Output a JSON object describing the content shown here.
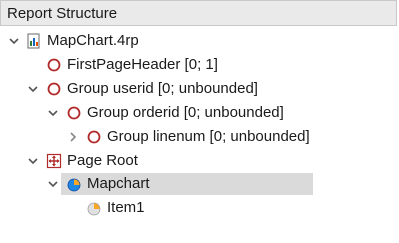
{
  "panel": {
    "title": "Report Structure"
  },
  "tree": {
    "root_file": "MapChart.4rp",
    "first_page_header": "FirstPageHeader [0; 1]",
    "group_userid": "Group userid [0; unbounded]",
    "group_orderid": "Group orderid [0; unbounded]",
    "group_linenum": "Group linenum [0; unbounded]",
    "page_root": "Page Root",
    "mapchart": "Mapchart",
    "item1": "Item1"
  },
  "colors": {
    "header_bg": "#eaeaea",
    "selection_bg": "#dadada",
    "group_circle": "#b22b2b",
    "chevron": "#555555"
  },
  "icons": {
    "root_file": "report-file-icon",
    "group": "group-circle-icon",
    "page_root": "page-root-icon",
    "mapchart": "map-chart-icon",
    "item": "map-item-icon"
  }
}
